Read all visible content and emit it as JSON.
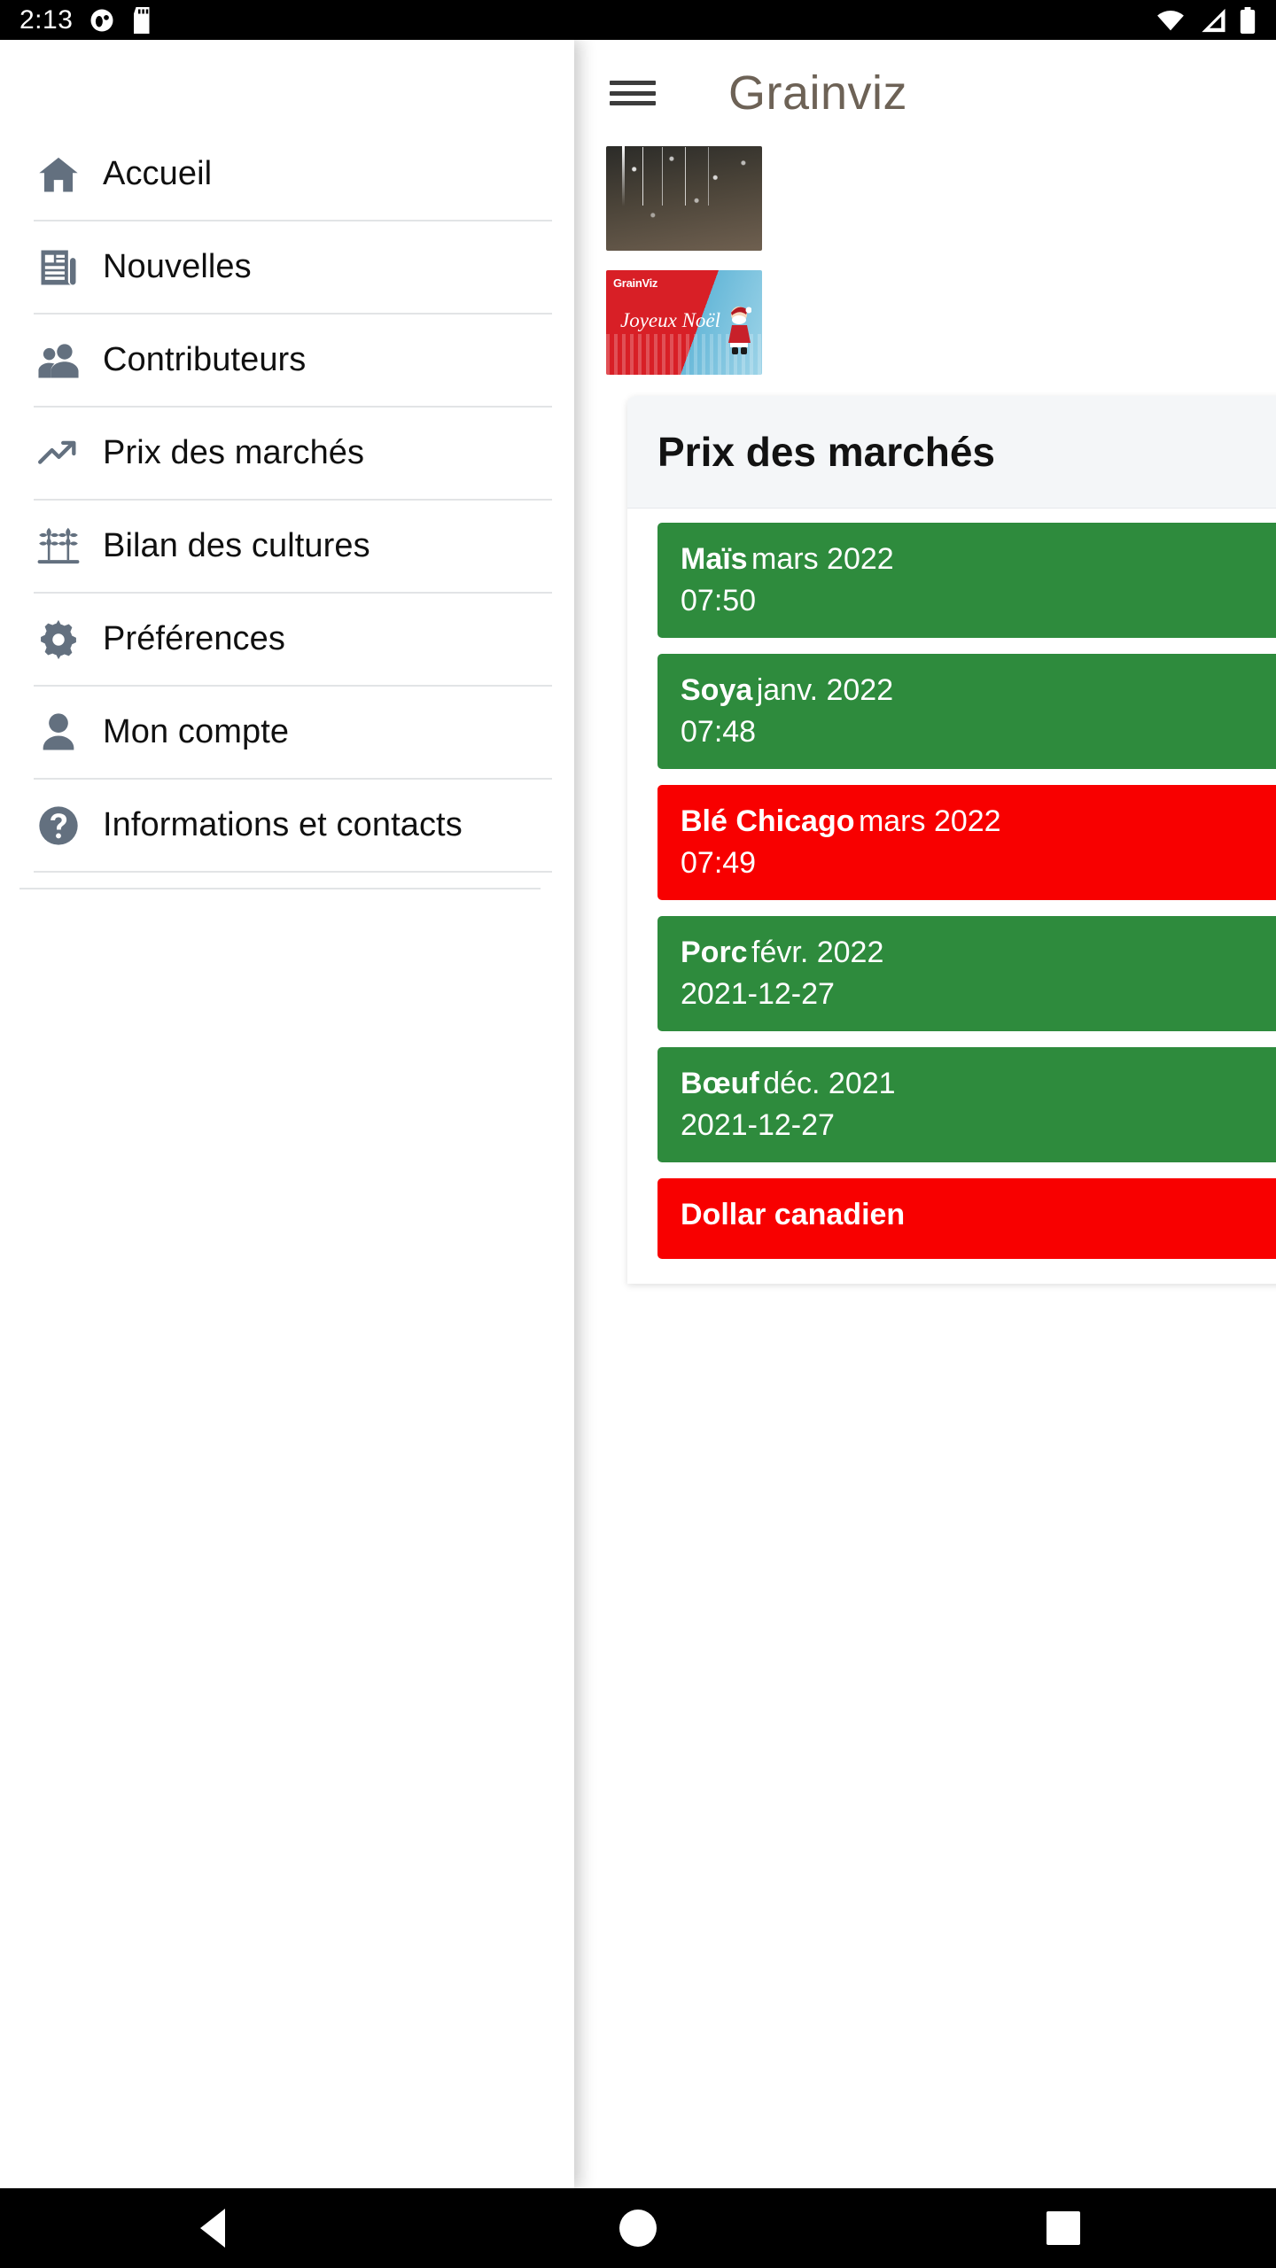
{
  "status_bar": {
    "time": "2:13",
    "left_icons": [
      "notification-dot-icon",
      "sd-card-icon"
    ],
    "right_icons": [
      "wifi-icon",
      "cell-signal-icon",
      "battery-icon"
    ]
  },
  "app": {
    "title": "Grainviz",
    "menu_icon": "hamburger-icon",
    "news_thumbnails": [
      {
        "name": "winter-drought-thumbnail",
        "alt": ""
      },
      {
        "name": "joyeux-noel-banner",
        "logo": "GrainViz",
        "greeting": "Joyeux Noël"
      }
    ],
    "prices_card": {
      "heading": "Prix des marchés",
      "rows": [
        {
          "commodity": "Maïs",
          "contract": "mars 2022",
          "time": "07:50",
          "color": "#2e8b3d"
        },
        {
          "commodity": "Soya",
          "contract": "janv. 2022",
          "time": "07:48",
          "color": "#2e8b3d"
        },
        {
          "commodity": "Blé Chicago",
          "contract": "mars 2022",
          "time": "07:49",
          "color": "#f80000"
        },
        {
          "commodity": "Porc",
          "contract": "févr. 2022",
          "time": "2021-12-27",
          "color": "#2e8b3d"
        },
        {
          "commodity": "Bœuf",
          "contract": "déc. 2021",
          "time": "2021-12-27",
          "color": "#2e8b3d"
        },
        {
          "commodity": "Dollar canadien",
          "contract": "",
          "time": "",
          "color": "#f80000"
        }
      ]
    }
  },
  "drawer": {
    "icon_color": "#63707f",
    "items": [
      {
        "label": "Accueil",
        "icon": "home-icon"
      },
      {
        "label": "Nouvelles",
        "icon": "newspaper-icon"
      },
      {
        "label": "Contributeurs",
        "icon": "people-icon"
      },
      {
        "label": "Prix des marchés",
        "icon": "trending-up-icon"
      },
      {
        "label": "Bilan des cultures",
        "icon": "wheat-icon"
      },
      {
        "label": "Préférences",
        "icon": "gear-icon"
      },
      {
        "label": "Mon compte",
        "icon": "person-icon"
      },
      {
        "label": "Informations et contacts",
        "icon": "help-circle-icon"
      }
    ]
  },
  "system_nav": {
    "back": "back-triangle-icon",
    "home": "home-circle-icon",
    "recents": "recents-square-icon"
  }
}
